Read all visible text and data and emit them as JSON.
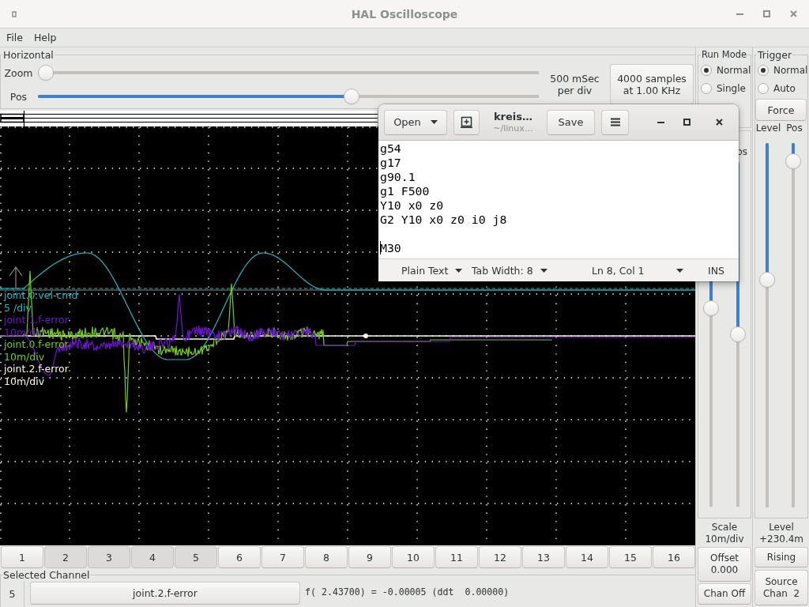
{
  "window": {
    "title": "HAL Oscilloscope"
  },
  "menu": [
    "File",
    "Help"
  ],
  "horizontal": {
    "title": "Horizontal",
    "zoom": {
      "label": "Zoom",
      "level": 0
    },
    "pos": {
      "label": "Pos",
      "level": 0.63
    },
    "time_per_div": "500 mSec\nper div",
    "samples_button": "4000 samples\nat 1.00 KHz"
  },
  "scope": {
    "channels": [
      {
        "name": "joint.0.vel-cmd",
        "scale": "5 /div",
        "color": "#17bcc6"
      },
      {
        "name": "joint.1.f-error",
        "scale": "10m/div",
        "color": "#7012d8"
      },
      {
        "name": "joint.0.f-error",
        "scale": "10m/div",
        "color": "#72d000"
      },
      {
        "name": "joint.2.f-error",
        "scale": "10m/div",
        "color": "#fff8e6"
      }
    ]
  },
  "channel_buttons": [
    {
      "label": "1",
      "on": false
    },
    {
      "label": "2",
      "on": true
    },
    {
      "label": "3",
      "on": true
    },
    {
      "label": "4",
      "on": true
    },
    {
      "label": "5",
      "on": true
    },
    {
      "label": "6",
      "on": false
    },
    {
      "label": "7",
      "on": false
    },
    {
      "label": "8",
      "on": false
    },
    {
      "label": "9",
      "on": false
    },
    {
      "label": "10",
      "on": false
    },
    {
      "label": "11",
      "on": false
    },
    {
      "label": "12",
      "on": false
    },
    {
      "label": "13",
      "on": false
    },
    {
      "label": "14",
      "on": false
    },
    {
      "label": "15",
      "on": false
    },
    {
      "label": "16",
      "on": false
    }
  ],
  "selected_channel": {
    "title": "Selected Channel",
    "number": "5",
    "name": "joint.2.f-error",
    "readout": "f( 2.43700) = -0.00005 (ddt  0.00000)"
  },
  "run_mode": {
    "title": "Run Mode",
    "options": [
      {
        "label": "Normal",
        "selected": true
      },
      {
        "label": "Single",
        "selected": false
      }
    ]
  },
  "vertical": {
    "pos_label": "os",
    "sliders": [
      {
        "level": 0.42
      },
      {
        "level": 0.5
      }
    ],
    "scale_readout": "Scale\n10m/div",
    "offset_button": "Offset\n0.000",
    "chan_off_button": "Chan Off"
  },
  "trigger": {
    "title": "Trigger",
    "options": [
      {
        "label": "Normal",
        "selected": true
      },
      {
        "label": "Auto",
        "selected": false
      }
    ],
    "force_button": "Force",
    "slider_labels": [
      "Level",
      "Pos"
    ],
    "sliders": [
      {
        "level": 0.37
      },
      {
        "level": 0.03
      }
    ],
    "level_readout": "Level\n+230.4m",
    "edge_button": "Rising",
    "source_button": "Source\nChan  2"
  },
  "editor": {
    "open_button": "Open",
    "title": "kreis…",
    "subtitle": "~/linux…",
    "save_button": "Save",
    "text": "g54\ng17\ng90.1\ng1 F500\nY10 x0 z0\nG2 Y10 x0 z0 i0 j8\n\nM30",
    "cursor": true,
    "language": "Plain Text",
    "tab_width": "Tab Width: 8",
    "cursor_position": "Ln 8, Col 1",
    "insert_mode": "INS"
  }
}
